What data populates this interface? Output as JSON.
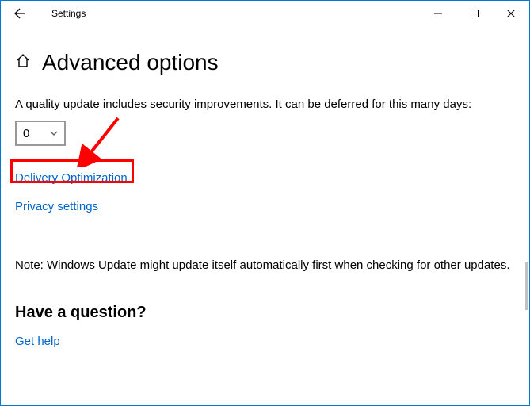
{
  "window": {
    "title": "Settings"
  },
  "header": {
    "heading": "Advanced options"
  },
  "body": {
    "quality_update_text": "A quality update includes security improvements. It can be deferred for this many days:",
    "defer_value": "0",
    "delivery_link": "Delivery Optimization",
    "privacy_link": "Privacy settings",
    "note_text": "Note: Windows Update might update itself automatically first when checking for other updates."
  },
  "footer": {
    "question_heading": "Have a question?",
    "help_link": "Get help"
  },
  "icons": {
    "back": "back-arrow-icon",
    "home": "home-icon",
    "minimize": "minimize-icon",
    "maximize": "maximize-icon",
    "close": "close-icon",
    "chevron": "chevron-down-icon"
  }
}
